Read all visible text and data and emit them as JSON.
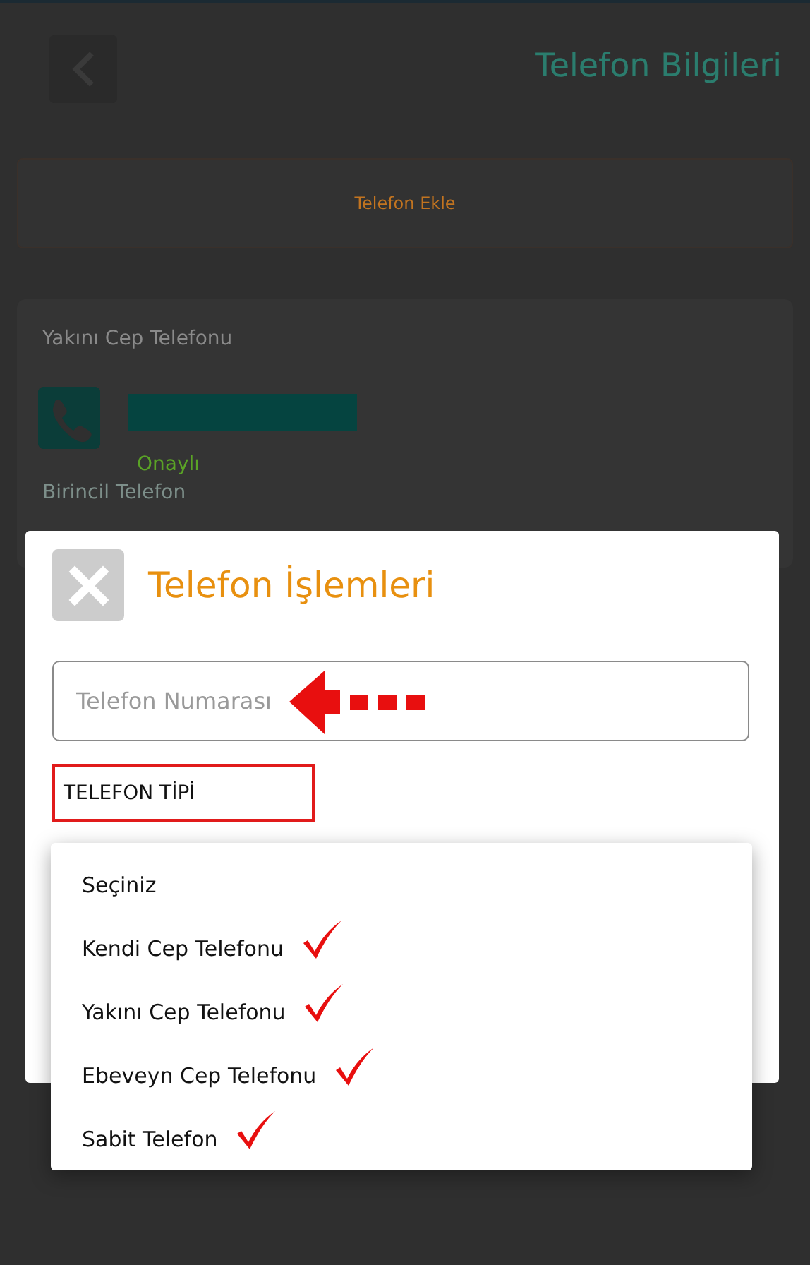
{
  "header": {
    "title": "Telefon Bilgileri"
  },
  "add_phone_button": {
    "label": "Telefon Ekle"
  },
  "phone_card": {
    "type_label": "Yakını Cep Telefonu",
    "status": "Onaylı",
    "primary_label": "Birincil Telefon"
  },
  "dialog": {
    "title": "Telefon İşlemleri",
    "phone_field": {
      "placeholder": "Telefon Numarası"
    },
    "type_label": "TELEFON TİPİ",
    "type_options": [
      {
        "label": "Seçiniz",
        "annotated": false
      },
      {
        "label": "Kendi Cep Telefonu",
        "annotated": true
      },
      {
        "label": "Yakını Cep Telefonu",
        "annotated": true
      },
      {
        "label": "Ebeveyn Cep Telefonu",
        "annotated": true
      },
      {
        "label": "Sabit Telefon",
        "annotated": true
      }
    ]
  }
}
